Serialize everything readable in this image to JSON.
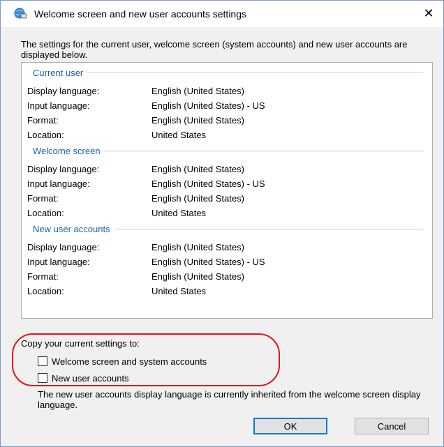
{
  "window": {
    "title": "Welcome screen and new user accounts settings",
    "close_label": "✕"
  },
  "intro": "The settings for the current user, welcome screen (system accounts) and new user accounts are displayed below.",
  "sections": [
    {
      "title": "Current user",
      "rows": [
        {
          "label": "Display language:",
          "value": "English (United States)"
        },
        {
          "label": "Input language:",
          "value": "English (United States) - US"
        },
        {
          "label": "Format:",
          "value": "English (United States)"
        },
        {
          "label": "Location:",
          "value": "United States"
        }
      ]
    },
    {
      "title": "Welcome screen",
      "rows": [
        {
          "label": "Display language:",
          "value": "English (United States)"
        },
        {
          "label": "Input language:",
          "value": "English (United States) - US"
        },
        {
          "label": "Format:",
          "value": "English (United States)"
        },
        {
          "label": "Location:",
          "value": "United States"
        }
      ]
    },
    {
      "title": "New user accounts",
      "rows": [
        {
          "label": "Display language:",
          "value": "English (United States)"
        },
        {
          "label": "Input language:",
          "value": "English (United States) - US"
        },
        {
          "label": "Format:",
          "value": "English (United States)"
        },
        {
          "label": "Location:",
          "value": "United States"
        }
      ]
    }
  ],
  "copy": {
    "label": "Copy your current settings to:",
    "options": [
      {
        "label": "Welcome screen and system accounts",
        "checked": false
      },
      {
        "label": "New user accounts",
        "checked": false
      }
    ]
  },
  "note": "The new user accounts display language is currently inherited from the welcome screen display language.",
  "buttons": {
    "ok": "OK",
    "cancel": "Cancel"
  },
  "colors": {
    "section_title": "#1b5fb5",
    "highlight": "#e0141e",
    "default_button_border": "#0078d7"
  }
}
